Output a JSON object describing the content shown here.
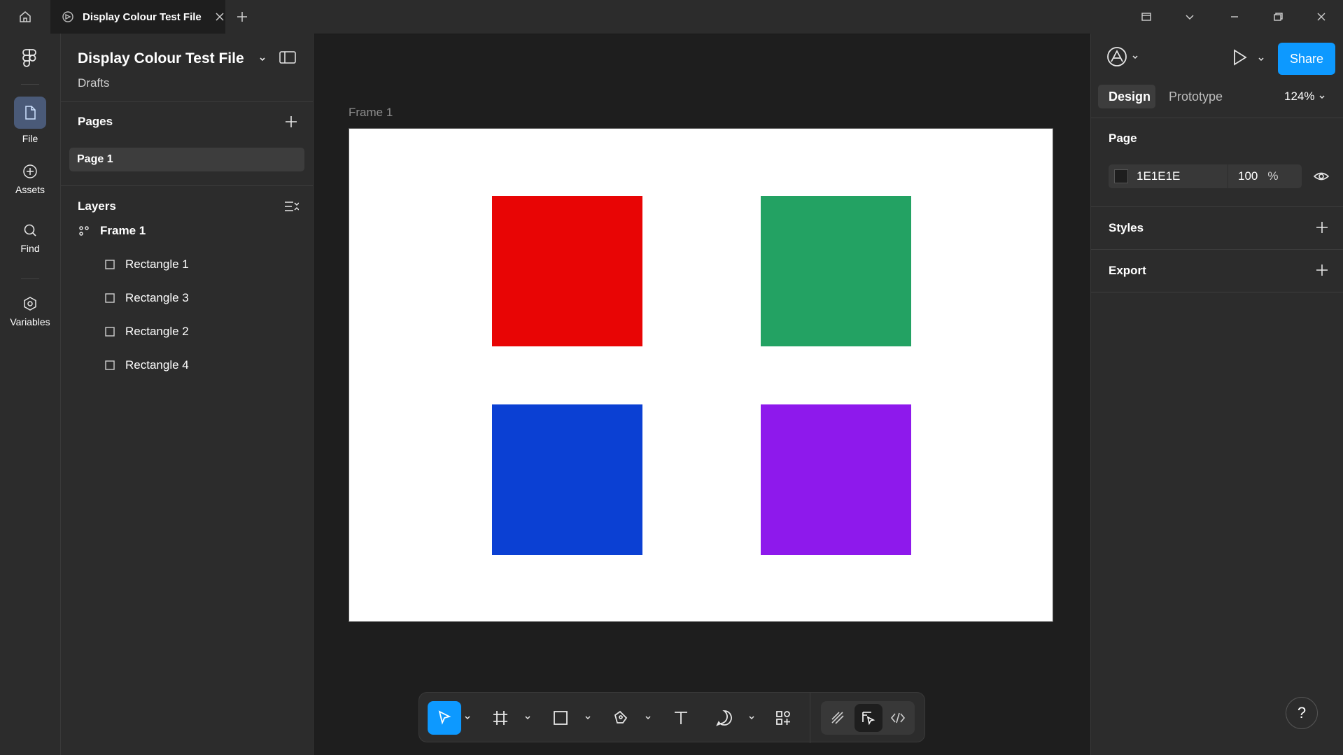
{
  "window": {
    "tab_title": "Display Colour Test File"
  },
  "rail": {
    "items": [
      {
        "label": "File",
        "icon": "file-icon"
      },
      {
        "label": "Assets",
        "icon": "plus-circle-icon"
      },
      {
        "label": "Find",
        "icon": "search-icon"
      },
      {
        "label": "Variables",
        "icon": "hexagon-icon"
      }
    ]
  },
  "left_panel": {
    "file_title": "Display Colour Test File",
    "location": "Drafts",
    "pages_title": "Pages",
    "pages": [
      "Page 1"
    ],
    "layers_title": "Layers",
    "layers": {
      "frame": "Frame 1",
      "children": [
        "Rectangle 1",
        "Rectangle 3",
        "Rectangle 2",
        "Rectangle 4"
      ]
    }
  },
  "canvas": {
    "frame_label": "Frame 1",
    "frame_fill": "#ffffff",
    "rectangles": [
      {
        "name": "Rectangle 1",
        "color": "#e80505"
      },
      {
        "name": "Rectangle 3",
        "color": "#23a263"
      },
      {
        "name": "Rectangle 2",
        "color": "#0b40d3"
      },
      {
        "name": "Rectangle 4",
        "color": "#8e19ec"
      }
    ]
  },
  "toolbar": {
    "tools": [
      "move-tool",
      "frame-tool",
      "shape-tool",
      "pen-tool",
      "text-tool",
      "comment-tool",
      "actions-tool",
      "draw-mode",
      "design-mode",
      "dev-mode"
    ],
    "active_tool": "move-tool",
    "accent": "#0d99ff"
  },
  "right_panel": {
    "share_label": "Share",
    "tabs": [
      "Design",
      "Prototype"
    ],
    "active_tab": "Design",
    "zoom": "124%",
    "page_section": "Page",
    "page_color_hex": "1E1E1E",
    "page_color_swatch": "#1e1e1e",
    "page_opacity": "100",
    "percent_sign": "%",
    "styles_title": "Styles",
    "export_title": "Export",
    "help_label": "?"
  }
}
